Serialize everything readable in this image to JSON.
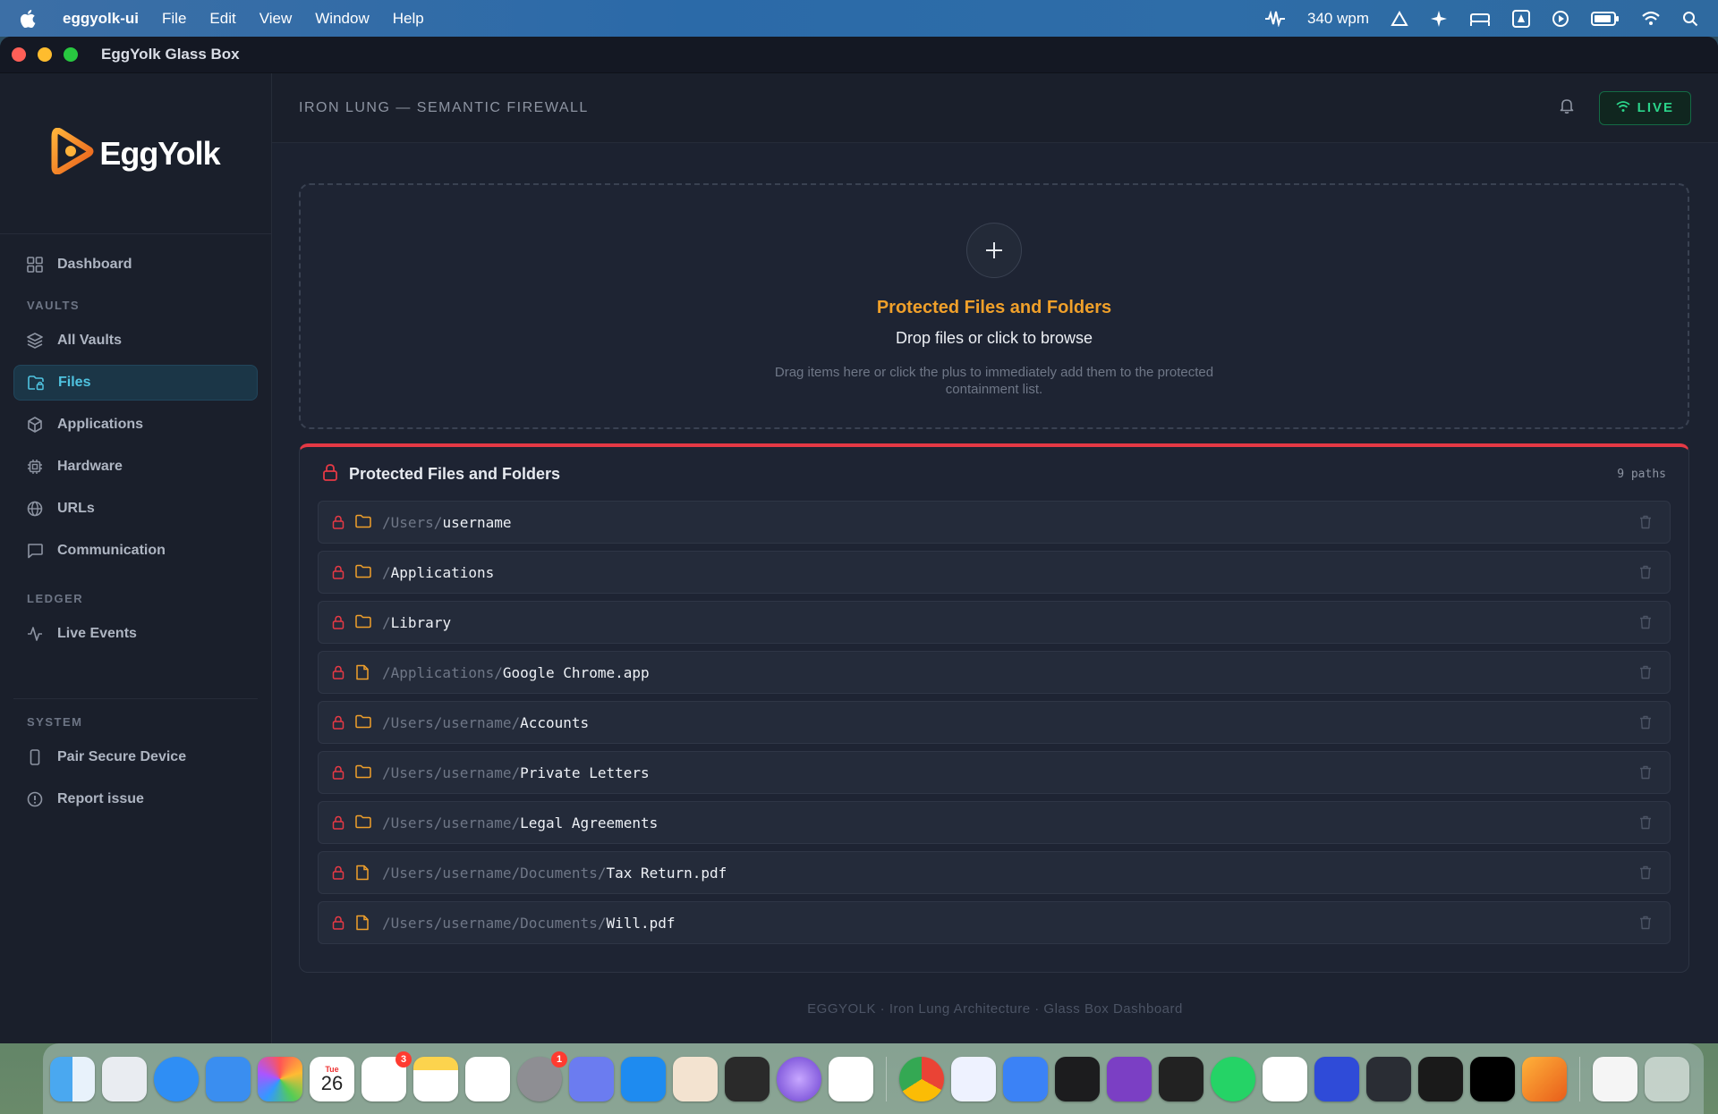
{
  "menubar": {
    "app_name": "eggyolk-ui",
    "menus": [
      "File",
      "Edit",
      "View",
      "Window",
      "Help"
    ],
    "wpm": "340 wpm"
  },
  "window": {
    "title": "EggYolk Glass Box"
  },
  "sidebar": {
    "logo_text": "EggYolk",
    "dashboard": "Dashboard",
    "vaults_section": "VAULTS",
    "items": [
      {
        "label": "All Vaults",
        "icon": "layers-icon"
      },
      {
        "label": "Files",
        "icon": "folder-lock-icon",
        "active": true
      },
      {
        "label": "Applications",
        "icon": "package-icon"
      },
      {
        "label": "Hardware",
        "icon": "cpu-icon"
      },
      {
        "label": "URLs",
        "icon": "globe-icon"
      },
      {
        "label": "Communication",
        "icon": "message-icon"
      }
    ],
    "ledger_section": "LEDGER",
    "live_events": "Live Events",
    "system_section": "SYSTEM",
    "pair_device": "Pair Secure Device",
    "report_issue": "Report issue"
  },
  "header": {
    "page_title": "IRON LUNG — SEMANTIC FIREWALL",
    "live_label": "LIVE"
  },
  "dropzone": {
    "title": "Protected Files and Folders",
    "subtitle": "Drop files or click to browse",
    "help": "Drag items here or click the plus to immediately add them to the protected containment list."
  },
  "panel": {
    "title": "Protected Files and Folders",
    "count": "9 paths",
    "rows": [
      {
        "prefix": "/Users/",
        "name": "username",
        "type": "folder"
      },
      {
        "prefix": "/",
        "name": "Applications",
        "type": "folder"
      },
      {
        "prefix": "/",
        "name": "Library",
        "type": "folder"
      },
      {
        "prefix": "/Applications/",
        "name": "Google Chrome.app",
        "type": "file"
      },
      {
        "prefix": "/Users/username/",
        "name": "Accounts",
        "type": "folder"
      },
      {
        "prefix": "/Users/username/",
        "name": "Private Letters",
        "type": "folder"
      },
      {
        "prefix": "/Users/username/",
        "name": "Legal Agreements",
        "type": "folder"
      },
      {
        "prefix": "/Users/username/Documents/",
        "name": "Tax Return.pdf",
        "type": "file"
      },
      {
        "prefix": "/Users/username/Documents/",
        "name": "Will.pdf",
        "type": "file"
      }
    ]
  },
  "footer": {
    "text": "EGGYOLK · Iron Lung Architecture · Glass Box Dashboard"
  },
  "dock": {
    "calendar_day": "Tue",
    "calendar_date": "26",
    "reminders_badge": "3",
    "settings_badge": "1"
  },
  "colors": {
    "accent_cyan": "#4fc3e0",
    "accent_orange": "#f0a02a",
    "danger_red": "#e53945",
    "live_green": "#2bd48a"
  }
}
